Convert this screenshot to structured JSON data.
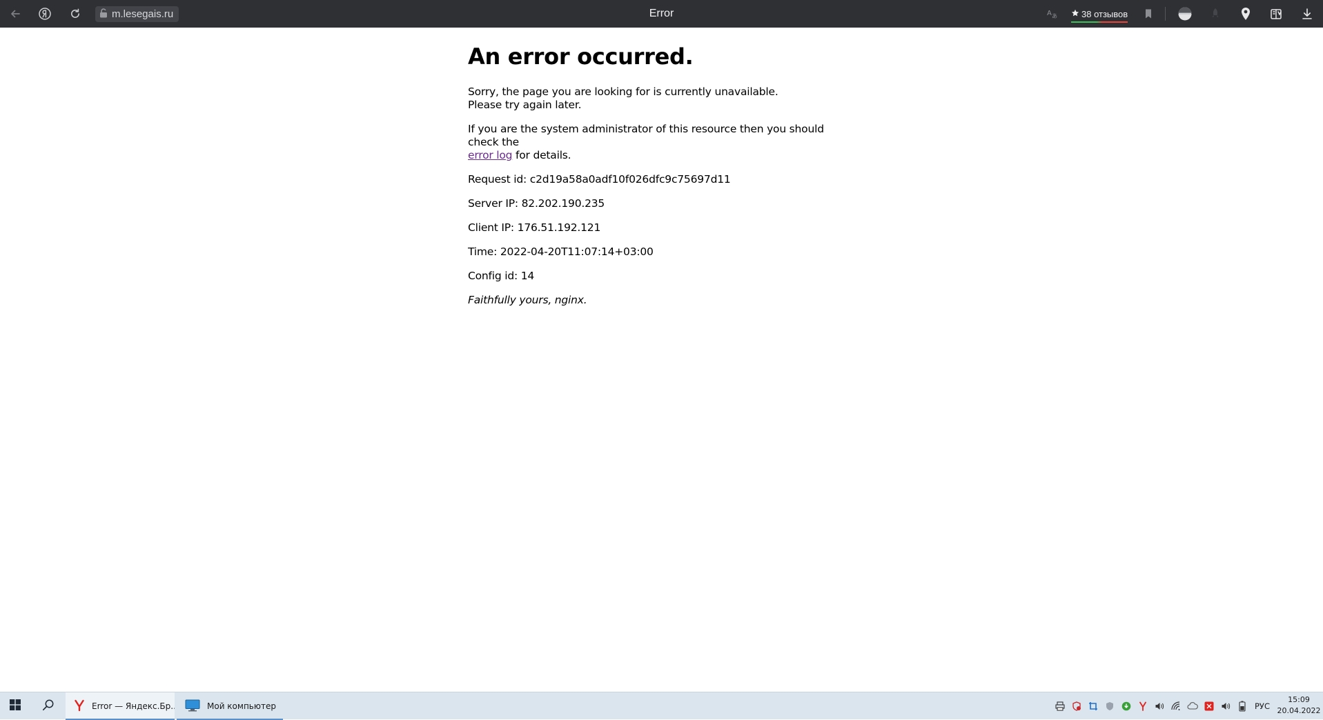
{
  "browser": {
    "tab_title": "Error",
    "url": "m.lesegais.ru",
    "reviews_label": "38 отзывов",
    "icons": {
      "back": "arrow-left-icon",
      "home": "yandex-logo-icon",
      "reload": "reload-icon",
      "lock": "unlocked-padlock-icon",
      "translate": "translate-icon",
      "star": "star-icon",
      "bookmark": "bookmark-icon",
      "protect": "protect-shield-icon",
      "turbo": "rocket-icon",
      "location": "location-pin-icon",
      "collections": "collections-icon",
      "downloads": "download-icon"
    }
  },
  "page": {
    "heading": "An error occurred.",
    "sorry_line1": "Sorry, the page you are looking for is currently unavailable.",
    "sorry_line2": "Please try again later.",
    "admin_text_before": "If you are the system administrator of this resource then you should check the",
    "admin_link": "error log",
    "admin_text_after": " for details.",
    "request_id": "Request id: c2d19a58a0adf10f026dfc9c75697d11",
    "server_ip": "Server IP: 82.202.190.235",
    "client_ip": "Client IP: 176.51.192.121",
    "time": "Time: 2022-04-20T11:07:14+03:00",
    "config_id": "Config id: 14",
    "signature": "Faithfully yours, nginx.",
    "link_color": "#6a2a8f"
  },
  "taskbar": {
    "items": [
      {
        "label": "Error — Яндекс.Бр...",
        "icon": "yandex-browser-icon",
        "active": true
      },
      {
        "label": "Мой компьютер",
        "icon": "computer-monitor-icon",
        "active": false
      }
    ],
    "language": "РУС",
    "clock_time": "15:09",
    "clock_date": "20.04.2022",
    "icons": {
      "start": "windows-start-icon",
      "search": "search-icon"
    },
    "tray_icons": [
      "printer-icon",
      "shield-alert-icon",
      "crop-tool-icon",
      "security-shield-icon",
      "torrent-icon",
      "yandex-icon",
      "speaker-icon",
      "wifi-icon",
      "cloud-icon",
      "record-icon",
      "volume-icon",
      "battery-icon"
    ]
  }
}
